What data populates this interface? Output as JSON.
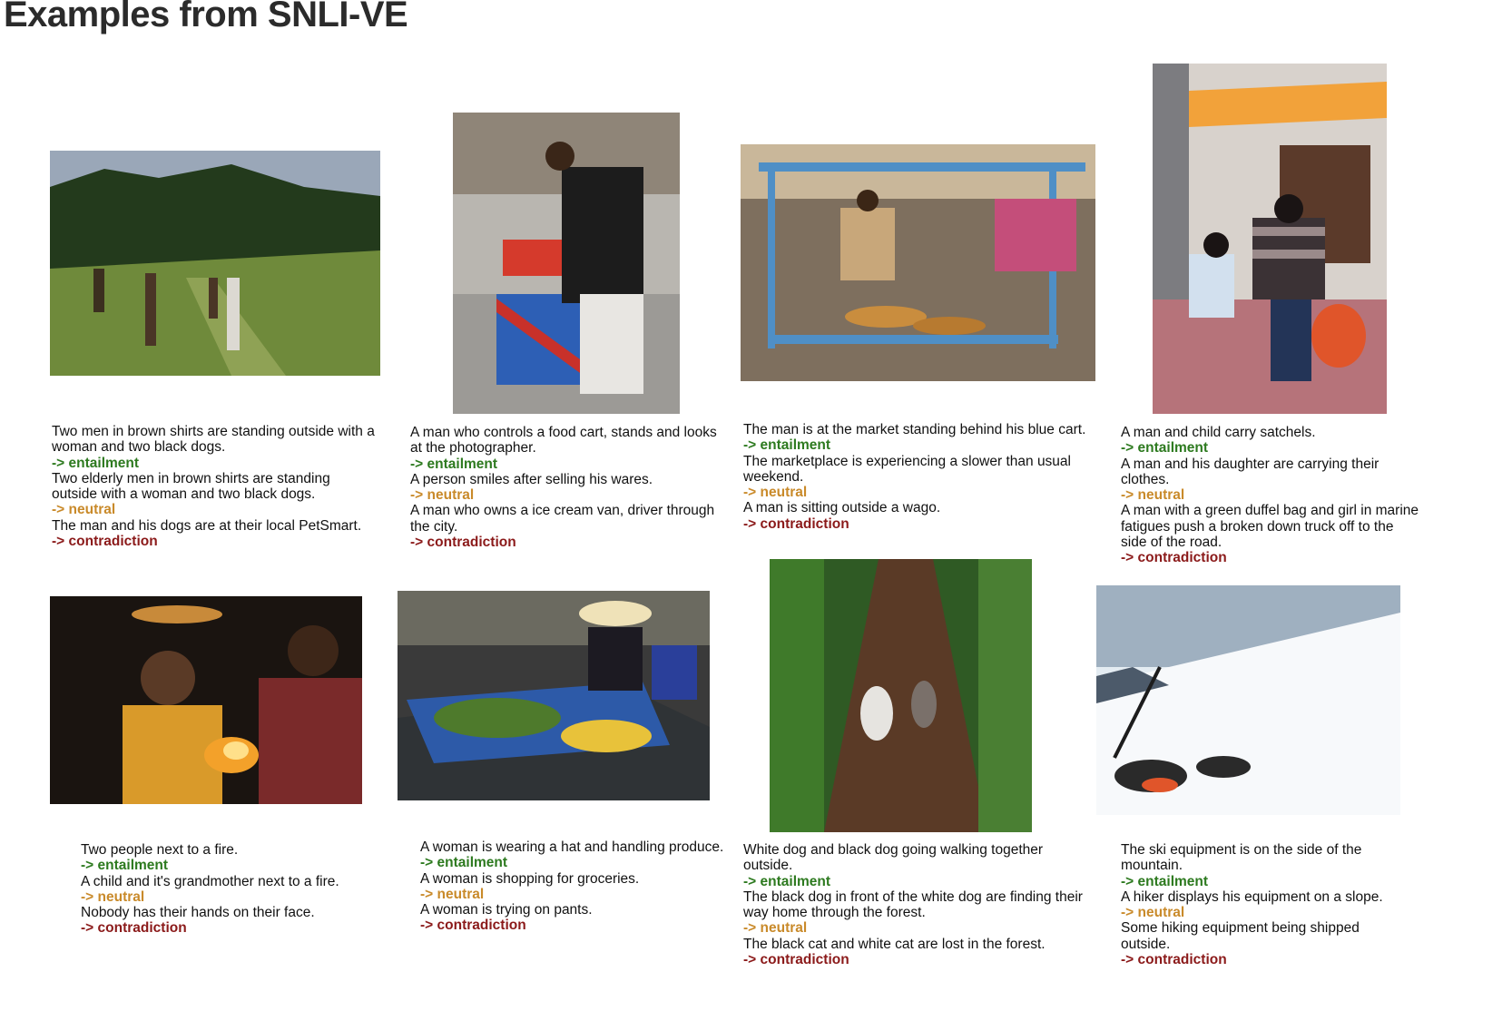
{
  "title": "Examples from SNLI-VE",
  "colors": {
    "entailment": "#2d7a1f",
    "neutral": "#c98a2a",
    "contradiction": "#8b1a1a"
  },
  "examples": [
    {
      "hyp1": "Two men in brown shirts are standing outside with a woman and two black dogs.",
      "lab1": " -> entailment",
      "hyp2": "Two elderly men in brown shirts are standing outside with a woman and two black dogs.",
      "lab2": "-> neutral",
      "hyp3": "The man and his dogs are at their local PetSmart.",
      "lab3": "-> contradiction"
    },
    {
      "hyp1": "A man who controls a food cart, stands and looks at the photographer.",
      "lab1": "-> entailment",
      "hyp2": "A person smiles after selling his wares.",
      "lab2": "-> neutral",
      "hyp3": "A man who owns a ice cream van, driver through the city.",
      "lab3": "-> contradiction"
    },
    {
      "hyp1": "The man is at the market standing behind his blue cart.",
      "lab1": "-> entailment",
      "hyp2": "The marketplace is experiencing a slower than usual weekend.",
      "lab2": "-> neutral",
      "hyp3": "A man is sitting outside a wago.",
      "lab3": "-> contradiction"
    },
    {
      "hyp1": "A man and child carry satchels.",
      "lab1": "-> entailment",
      "hyp2": "A man and his daughter are carrying their clothes.",
      "lab2": "-> neutral",
      "hyp3": "A man with a green duffel bag and girl in marine fatigues push a broken down truck off to the side of the road.",
      "lab3": "-> contradiction"
    },
    {
      "hyp1": "Two people next to a fire.",
      "lab1": "-> entailment",
      "hyp2": "A child and it's grandmother next to a fire.",
      "lab2": "-> neutral",
      "hyp3": "Nobody has their hands on their face.",
      "lab3": "-> contradiction"
    },
    {
      "hyp1": "A woman is wearing a hat and handling produce.",
      "lab1": "-> entailment",
      "hyp2": "A woman is shopping for groceries.",
      "lab2": "-> neutral",
      "hyp3": "A woman is trying on pants.",
      "lab3": "-> contradiction"
    },
    {
      "hyp1": "White dog and black dog going walking together outside.",
      "lab1": "-> entailment",
      "hyp2": "The black dog in front of the white dog are finding their way home through the forest.",
      "lab2": "-> neutral",
      "hyp3": "The black cat and white cat are lost in the forest.",
      "lab3": "-> contradiction"
    },
    {
      "hyp1": "The ski equipment is on the side of the mountain.",
      "lab1": "-> entailment",
      "hyp2": "A hiker displays his equipment on a slope.",
      "lab2": "-> neutral",
      "hyp3": "Some hiking equipment being shipped outside.",
      "lab3": "-> contradiction"
    }
  ]
}
